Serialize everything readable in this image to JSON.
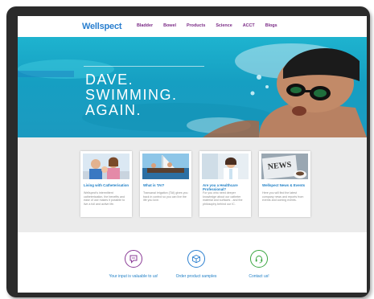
{
  "nav": {
    "logo": "Wellspect",
    "items": [
      "Bladder",
      "Bowel",
      "Products",
      "Science",
      "ACCT",
      "Blogs"
    ]
  },
  "hero": {
    "lines": [
      "DAVE.",
      "SWIMMING.",
      "AGAIN."
    ]
  },
  "cards": [
    {
      "title": "Living with Catheterisation",
      "desc": "Wellspect's intermittent catheterisation, the benefits and ease of use makes it possible to live a full and active life."
    },
    {
      "title": "What is TAI?",
      "desc": "Transanal irrigation (TAI) gives you back in control so you can live the life you love."
    },
    {
      "title": "Are you a Healthcare Professional?",
      "desc": "For you who need deeper knowledge about our catheter material and surfaces - and the philosophy behind our IC."
    },
    {
      "title": "Wellspect News & Events",
      "desc": "Here you will find the latest company news and reports from events and coming events."
    }
  ],
  "news_thumb_text": "NEWS",
  "ctas": [
    {
      "label": "Your input is valuable to us!",
      "icon": "chat-bubble-icon",
      "color": "#8a3a96"
    },
    {
      "label": "Order product samples",
      "icon": "box-icon",
      "color": "#2a7fcf"
    },
    {
      "label": "Contact us!",
      "icon": "headset-icon",
      "color": "#3aa640"
    }
  ]
}
